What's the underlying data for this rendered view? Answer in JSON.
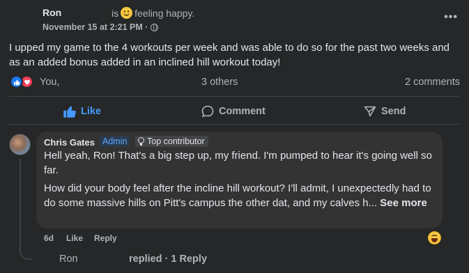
{
  "post": {
    "author": "Ron",
    "feeling_prefix": "is",
    "feeling_text": "feeling happy.",
    "date": "November 15 at 2:21 PM ·",
    "more_label": "•••",
    "body": "I upped my game to the 4 workouts per week and was able to do so for the past two weeks and as an added bonus added in an inclined hill workout today!",
    "reactors": "You,",
    "others": "3 others",
    "comments_count": "2 comments"
  },
  "actions": {
    "like": "Like",
    "comment": "Comment",
    "send": "Send"
  },
  "comment": {
    "author": "Chris Gates",
    "badge_admin": "Admin",
    "badge_top": "Top contributor",
    "paragraph1": "Hell yeah, Ron! That's a big step up, my friend. I'm pumped to hear it's going well so far.",
    "paragraph2": "How did your body feel after the incline hill workout? I'll admit, I unexpectedly had to do some massive hills on Pitt's campus the other dat, and my calves h...",
    "see_more": "See more",
    "time": "6d",
    "like": "Like",
    "reply": "Reply"
  },
  "reply_row": {
    "author": "Ron",
    "text": "replied · 1 Reply"
  },
  "colors": {
    "background": "#252728",
    "bubble": "#333334",
    "like_blue": "#4599ff",
    "admin_blue": "#5aa7ff",
    "love_red": "#f33e58"
  }
}
